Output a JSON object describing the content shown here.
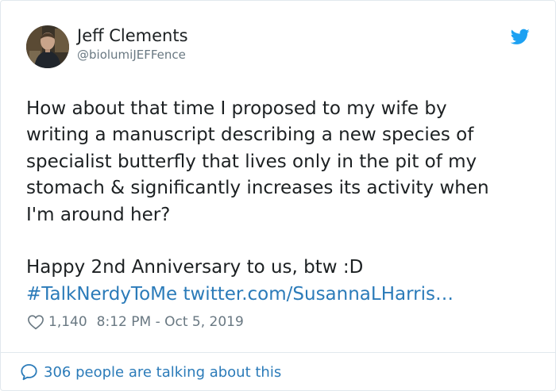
{
  "author": {
    "display_name": "Jeff Clements",
    "handle": "@biolumiJEFFence",
    "avatar_icon": "profile-photo"
  },
  "brand": {
    "icon": "twitter-bird-icon",
    "color": "#1da1f2"
  },
  "tweet": {
    "lines": [
      "How about that time I proposed to my wife by",
      "writing a manuscript describing a new species of",
      "specialist butterfly that lives only in the pit of my",
      "stomach & significantly increases its activity when",
      "I'm around her?"
    ],
    "line2": "Happy 2nd Anniversary to us, btw :D",
    "hashtag": "#TalkNerdyToMe",
    "link": "twitter.com/SusannaLHarris…"
  },
  "meta": {
    "likes": "1,140",
    "timestamp": "8:12 PM - Oct 5, 2019",
    "like_icon": "heart-icon"
  },
  "footer": {
    "label": "306 people are talking about this",
    "icon": "comment-bubble-icon"
  },
  "colors": {
    "text": "#1c2022",
    "secondary": "#697882",
    "link": "#2b7bb9",
    "border": "#e1e8ed"
  }
}
